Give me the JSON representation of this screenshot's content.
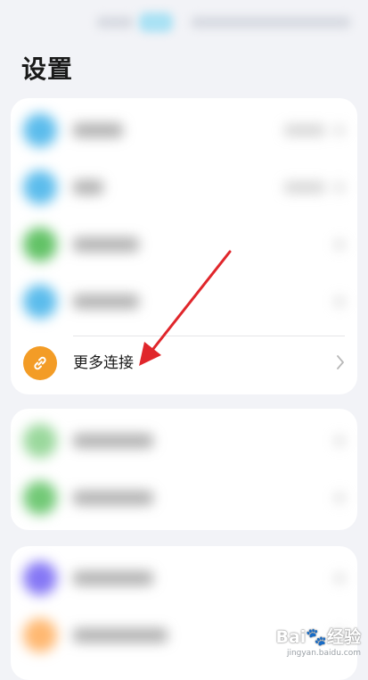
{
  "page_title": "设置",
  "colors": {
    "background": "#f2f3f7",
    "card": "#ffffff",
    "more_connections_icon": "#f39c26",
    "annotation_arrow": "#e0262b",
    "blurred_icons": [
      "#5bbcec",
      "#5bbcec",
      "#62c266",
      "#5bbcec",
      "#9ad89c",
      "#72c976",
      "#8577f5",
      "#ffb871"
    ]
  },
  "more_connections": {
    "label": "更多连接",
    "icon": "link-icon",
    "chevron": "chevron-right-icon"
  },
  "watermark": {
    "brand": "Bai",
    "brand_suffix": "经验",
    "url": "jingyan.baidu.com"
  }
}
